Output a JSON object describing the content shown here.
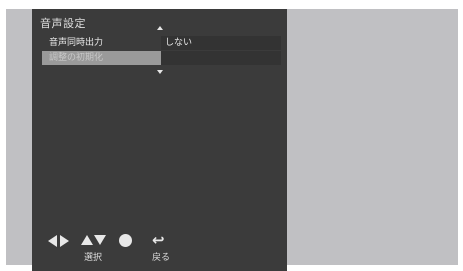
{
  "menu": {
    "title": "音声設定",
    "items": [
      {
        "label": "音声同時出力",
        "value": "しない"
      },
      {
        "label": "調整の初期化",
        "value": ""
      }
    ]
  },
  "controls": {
    "select_label": "選択",
    "back_label": "戻る"
  },
  "icons": {
    "left_right": "left-right-arrows-icon",
    "up_down": "up-down-arrows-icon",
    "enter": "enter-dot-icon",
    "back": "back-return-icon"
  },
  "colors": {
    "panel_bg": "#3b3b3b",
    "screen_bg": "#c0c0c3",
    "selected_row": "#9a9a9a"
  }
}
